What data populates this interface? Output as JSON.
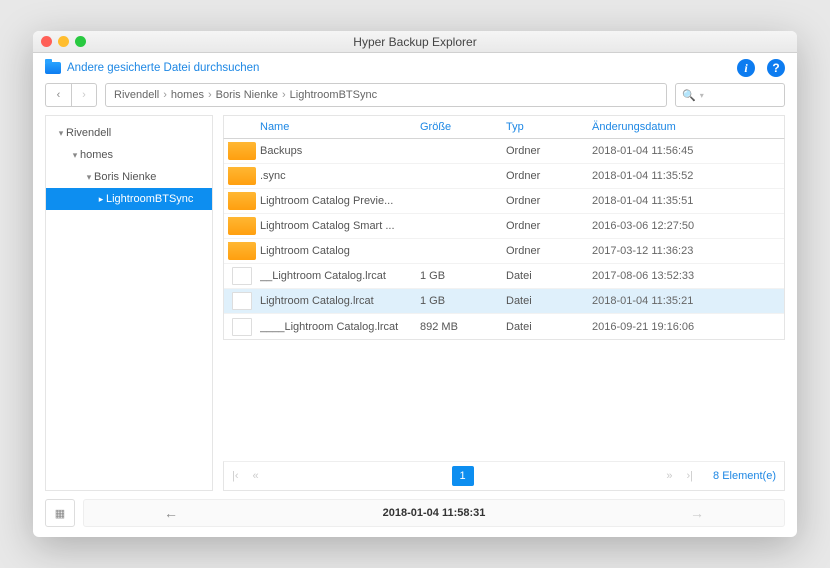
{
  "window": {
    "title": "Hyper Backup Explorer"
  },
  "toolbar": {
    "browse_link": "Andere gesicherte Datei durchsuchen"
  },
  "breadcrumb": [
    "Rivendell",
    "homes",
    "Boris Nienke",
    "LightroomBTSync"
  ],
  "search": {
    "placeholder": ""
  },
  "tree": [
    {
      "label": "Rivendell",
      "depth": 1,
      "expanded": true,
      "selected": false
    },
    {
      "label": "homes",
      "depth": 2,
      "expanded": true,
      "selected": false
    },
    {
      "label": "Boris Nienke",
      "depth": 3,
      "expanded": true,
      "selected": false
    },
    {
      "label": "LightroomBTSync",
      "depth": 4,
      "expanded": true,
      "selected": true
    }
  ],
  "columns": {
    "name": "Name",
    "size": "Größe",
    "type": "Typ",
    "date": "Änderungsdatum"
  },
  "files": [
    {
      "icon": "folder",
      "name": "Backups",
      "size": "",
      "type": "Ordner",
      "date": "2018-01-04 11:56:45",
      "selected": false
    },
    {
      "icon": "folder",
      "name": ".sync",
      "size": "",
      "type": "Ordner",
      "date": "2018-01-04 11:35:52",
      "selected": false
    },
    {
      "icon": "folder",
      "name": "Lightroom Catalog Previe...",
      "size": "",
      "type": "Ordner",
      "date": "2018-01-04 11:35:51",
      "selected": false
    },
    {
      "icon": "folder",
      "name": "Lightroom Catalog Smart ...",
      "size": "",
      "type": "Ordner",
      "date": "2016-03-06 12:27:50",
      "selected": false
    },
    {
      "icon": "folder",
      "name": "Lightroom Catalog",
      "size": "",
      "type": "Ordner",
      "date": "2017-03-12 11:36:23",
      "selected": false
    },
    {
      "icon": "file",
      "name": "__Lightroom Catalog.lrcat",
      "size": "1 GB",
      "type": "Datei",
      "date": "2017-08-06 13:52:33",
      "selected": false
    },
    {
      "icon": "file",
      "name": "Lightroom Catalog.lrcat",
      "size": "1 GB",
      "type": "Datei",
      "date": "2018-01-04 11:35:21",
      "selected": true
    },
    {
      "icon": "file",
      "name": "____Lightroom Catalog.lrcat",
      "size": "892 MB",
      "type": "Datei",
      "date": "2016-09-21 19:16:06",
      "selected": false
    }
  ],
  "pager": {
    "page": "1",
    "count_label": "8 Element(e)"
  },
  "footer": {
    "timestamp": "2018-01-04 11:58:31"
  }
}
